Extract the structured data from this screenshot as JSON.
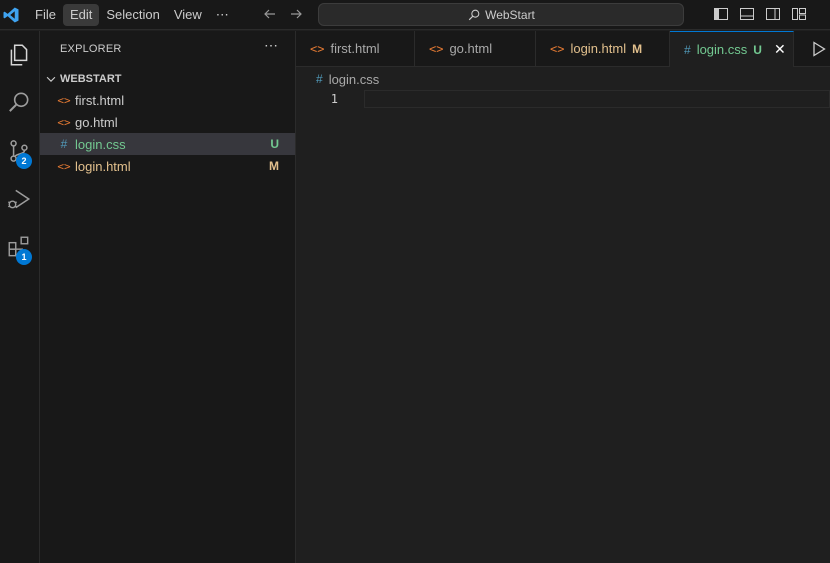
{
  "titlebar": {
    "menu": [
      "File",
      "Edit",
      "Selection",
      "View",
      "⋯"
    ],
    "search_text": "WebStart"
  },
  "activity": {
    "scm_badge": "2",
    "extensions_badge": "1"
  },
  "sidebar": {
    "title": "EXPLORER",
    "more": "⋯",
    "folder": "WEBSTART",
    "files": [
      {
        "name": "first.html",
        "icon": "<>",
        "status": "",
        "color": "#cccccc"
      },
      {
        "name": "go.html",
        "icon": "<>",
        "status": "",
        "color": "#cccccc"
      },
      {
        "name": "login.css",
        "icon": "#",
        "status": "U",
        "color": "#73c991"
      },
      {
        "name": "login.html",
        "icon": "<>",
        "status": "M",
        "color": "#e2c08d"
      }
    ]
  },
  "tabs": [
    {
      "name": "first.html",
      "icon": "<>",
      "status": ""
    },
    {
      "name": "go.html",
      "icon": "<>",
      "status": ""
    },
    {
      "name": "login.html",
      "icon": "<>",
      "status": "M"
    },
    {
      "name": "login.css",
      "icon": "#",
      "status": "U",
      "close": "✕"
    }
  ],
  "editor": {
    "breadcrumb_icon": "#",
    "breadcrumb": "login.css",
    "line_number": "1"
  },
  "colors": {
    "accent": "#0078d4",
    "untracked": "#73c991",
    "modified": "#e2c08d",
    "html_icon": "#e37933",
    "css_icon": "#519aba"
  }
}
